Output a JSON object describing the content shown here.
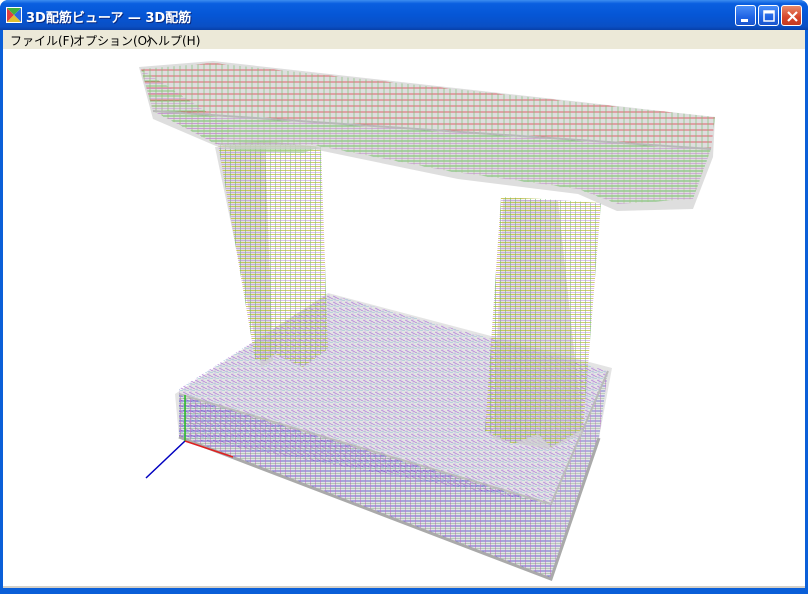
{
  "window": {
    "title": "3D配筋ビューア — 3D配筋",
    "app_icon": "app-logo-icon",
    "controls": {
      "minimize": "minimize-icon",
      "maximize": "maximize-icon",
      "close": "close-icon"
    }
  },
  "menu": {
    "items": [
      {
        "label": "ファイル(F)"
      },
      {
        "label": "オプション(O)"
      },
      {
        "label": "ヘルプ(H)"
      }
    ]
  },
  "viewport": {
    "content": "3D rebar wireframe model",
    "colors": {
      "rebar_red": "#e05a66",
      "rebar_green": "#6fbf6a",
      "rebar_yellow": "#d8d040",
      "rebar_purple": "#b07ad8",
      "rebar_blue": "#4040c8",
      "concrete_ghost": "#c8c8c8",
      "axis_x": "#e02020",
      "axis_y": "#20c020",
      "axis_z": "#0000c0"
    }
  }
}
